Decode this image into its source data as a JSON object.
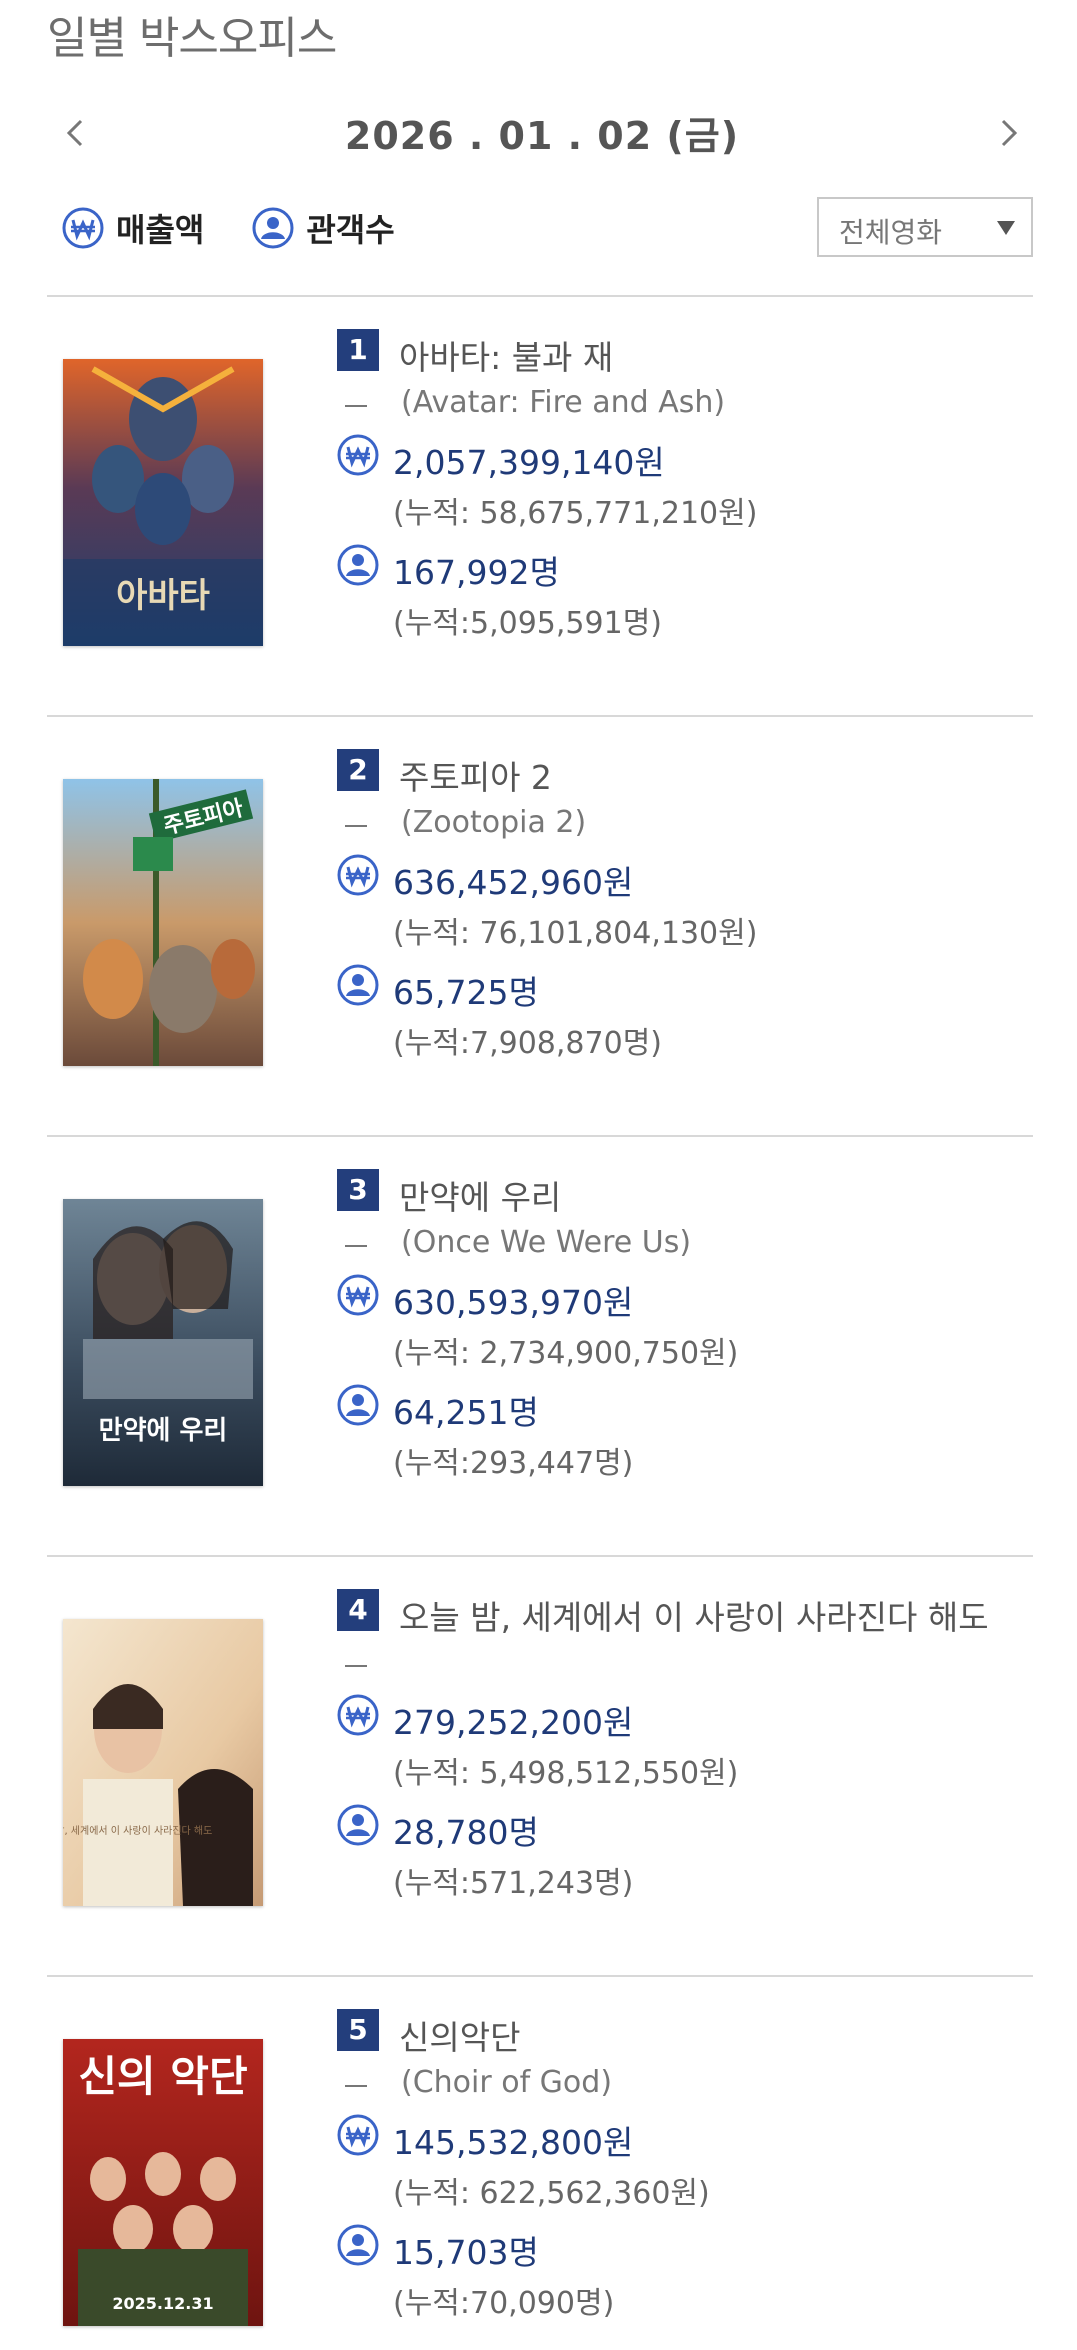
{
  "page_title": "일별 박스오피스",
  "date_nav": {
    "date": "2026 . 01 . 02  (금)"
  },
  "legend": {
    "sales_label": "매출액",
    "audience_label": "관객수"
  },
  "filter": {
    "selected": "전체영화"
  },
  "colors": {
    "accent": "#233e7c",
    "icon_blue": "#3a64c8",
    "value_text": "#1f3a78",
    "divider": "#d8d8d8"
  },
  "movies": [
    {
      "rank": "1",
      "title": "아바타: 불과 재",
      "original_title": "(Avatar: Fire and Ash)",
      "sales": "2,057,399,140원",
      "sales_cumulative": "(누적: 58,675,771,210원)",
      "audience": "167,992명",
      "audience_cumulative": "(누적:5,095,591명)",
      "poster_text": "아바타"
    },
    {
      "rank": "2",
      "title": "주토피아 2",
      "original_title": "(Zootopia 2)",
      "sales": "636,452,960원",
      "sales_cumulative": "(누적: 76,101,804,130원)",
      "audience": "65,725명",
      "audience_cumulative": "(누적:7,908,870명)",
      "poster_text": "주토피아"
    },
    {
      "rank": "3",
      "title": "만약에 우리",
      "original_title": "(Once We Were Us)",
      "sales": "630,593,970원",
      "sales_cumulative": "(누적: 2,734,900,750원)",
      "audience": "64,251명",
      "audience_cumulative": "(누적:293,447명)",
      "poster_text": "만약에 우리"
    },
    {
      "rank": "4",
      "title": "오늘 밤, 세계에서 이 사랑이 사라진다 해도",
      "original_title": "",
      "sales": "279,252,200원",
      "sales_cumulative": "(누적: 5,498,512,550원)",
      "audience": "28,780명",
      "audience_cumulative": "(누적:571,243명)",
      "poster_text": "오늘 밤, 세계에서 이 사랑이 사라진다 해도"
    },
    {
      "rank": "5",
      "title": "신의악단",
      "original_title": "(Choir of God)",
      "sales": "145,532,800원",
      "sales_cumulative": "(누적: 622,562,360원)",
      "audience": "15,703명",
      "audience_cumulative": "(누적:70,090명)",
      "poster_text": "신의 악단",
      "poster_date": "2025.12.31"
    }
  ]
}
